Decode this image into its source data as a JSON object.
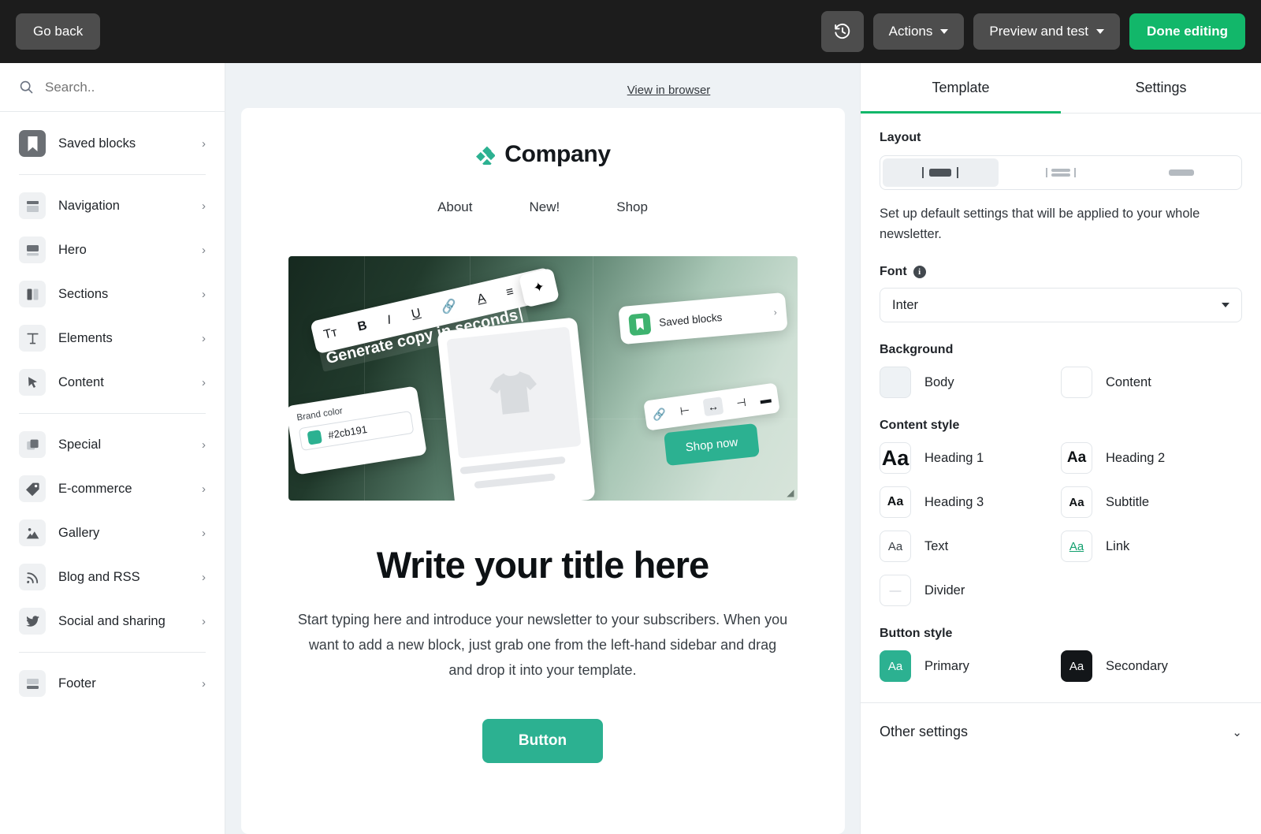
{
  "topbar": {
    "go_back": "Go back",
    "history_icon": "history-clock-icon",
    "actions": "Actions",
    "preview": "Preview and test",
    "done": "Done editing",
    "green": "#12b76a"
  },
  "sidebar": {
    "search_placeholder": "Search..",
    "search_icon": "search-icon",
    "groups": [
      {
        "items": [
          {
            "label": "Saved blocks",
            "icon": "bookmark-icon",
            "dark": true
          }
        ]
      },
      {
        "items": [
          {
            "label": "Navigation",
            "icon": "navigation-block-icon"
          },
          {
            "label": "Hero",
            "icon": "hero-block-icon"
          },
          {
            "label": "Sections",
            "icon": "columns-icon"
          },
          {
            "label": "Elements",
            "icon": "text-t-icon"
          },
          {
            "label": "Content",
            "icon": "cursor-arrow-icon"
          }
        ]
      },
      {
        "items": [
          {
            "label": "Special",
            "icon": "layers-icon"
          },
          {
            "label": "E-commerce",
            "icon": "price-tag-icon"
          },
          {
            "label": "Gallery",
            "icon": "image-mountain-icon"
          },
          {
            "label": "Blog and RSS",
            "icon": "rss-icon"
          },
          {
            "label": "Social and sharing",
            "icon": "twitter-bird-icon"
          }
        ]
      },
      {
        "items": [
          {
            "label": "Footer",
            "icon": "footer-block-icon"
          }
        ]
      }
    ]
  },
  "canvas": {
    "view_in_browser": "View in browser",
    "brand_name": "Company",
    "logo_icon": "four-diamond-logo-icon",
    "nav": [
      "About",
      "New!",
      "Shop"
    ],
    "hero": {
      "format_tools": [
        "Tᴛ",
        "B",
        "I",
        "U",
        "🔗",
        "A",
        "≡",
        "#"
      ],
      "sparkle_icon": "sparkle-ai-icon",
      "generate_copy": "Generate copy in seconds",
      "brand_color_label": "Brand color",
      "brand_color_hex": "#2cb191",
      "saved_blocks": "Saved blocks",
      "saved_blocks_icon": "bookmark-icon",
      "align_tools": [
        "🔗",
        "⊢",
        "↔",
        "⊣",
        "▬"
      ],
      "shop_now": "Shop now",
      "shirt_icon": "tshirt-placeholder-icon",
      "resize_handle_icon": "resize-corner-icon"
    },
    "title": "Write your title here",
    "body": "Start typing here and introduce your newsletter to your subscribers. When you want to add a new block, just grab one from the left-hand sidebar and drag and drop it into your template.",
    "button": "Button",
    "button_color": "#2cb191"
  },
  "panel": {
    "tabs": [
      {
        "label": "Template",
        "active": true
      },
      {
        "label": "Settings",
        "active": false
      }
    ],
    "layout_heading": "Layout",
    "layout_options": [
      "narrow-centered",
      "split-rows",
      "full-width"
    ],
    "note": "Set up default settings that will be applied to your whole newsletter.",
    "font_heading": "Font",
    "font_info_icon": "info-icon",
    "font_value": "Inter",
    "background_heading": "Background",
    "backgrounds": [
      {
        "label": "Body",
        "color": "#eef2f5"
      },
      {
        "label": "Content",
        "color": "#ffffff"
      }
    ],
    "content_style_heading": "Content style",
    "content_styles": [
      {
        "label": "Heading 1",
        "sample": "Aa",
        "size": 27,
        "weight": "bold",
        "color": "#0d1114"
      },
      {
        "label": "Heading 2",
        "sample": "Aa",
        "size": 19,
        "weight": "bold",
        "color": "#0d1114"
      },
      {
        "label": "Heading 3",
        "sample": "Aa",
        "size": 16,
        "weight": "bold",
        "color": "#0d1114"
      },
      {
        "label": "Subtitle",
        "sample": "Aa",
        "size": 15,
        "weight": "bold",
        "color": "#0d1114"
      },
      {
        "label": "Text",
        "sample": "Aa",
        "size": 15,
        "weight": "normal",
        "color": "#3a4046"
      },
      {
        "label": "Link",
        "sample": "Aa",
        "size": 15,
        "weight": "normal",
        "color": "#12a06e"
      },
      {
        "label": "Divider",
        "sample": "—",
        "size": 15,
        "weight": "normal",
        "color": "#c9ced3"
      }
    ],
    "button_style_heading": "Button style",
    "button_styles": [
      {
        "label": "Primary",
        "sample": "Aa",
        "bg": "#2cb191",
        "fg": "#ffffff"
      },
      {
        "label": "Secondary",
        "sample": "Aa",
        "bg": "#131619",
        "fg": "#ffffff"
      }
    ],
    "other_settings": "Other settings",
    "other_chevron_icon": "chevron-down-icon"
  }
}
